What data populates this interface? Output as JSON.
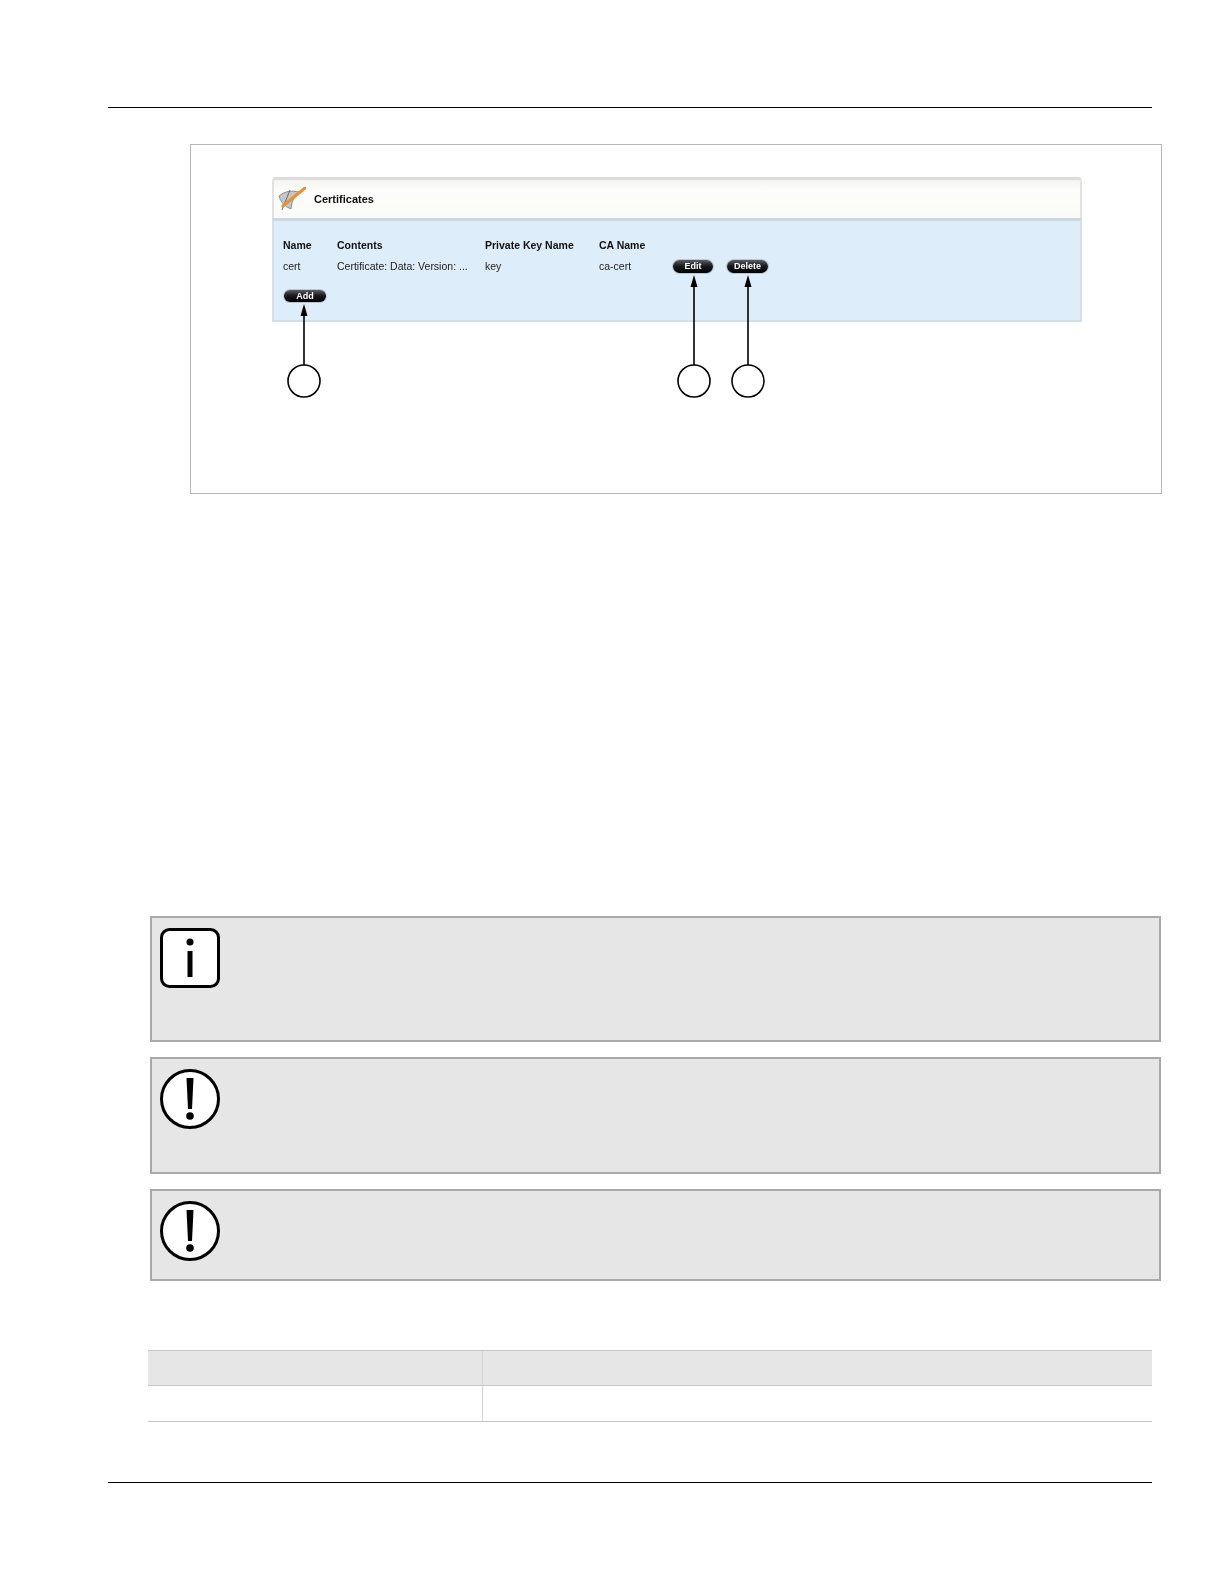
{
  "figure": {
    "panel": {
      "title": "Certificates",
      "columns": [
        "Name",
        "Contents",
        "Private Key Name",
        "CA Name"
      ],
      "rows": [
        {
          "cells": [
            "cert",
            "Certificate: Data: Version: ...",
            "key",
            "ca-cert"
          ],
          "actions": [
            {
              "kind": "edit",
              "label": "Edit"
            },
            {
              "kind": "delete",
              "label": "Delete"
            }
          ]
        }
      ],
      "add_button": "Add"
    }
  },
  "notes": [
    {
      "kind": "info"
    },
    {
      "kind": "warning"
    },
    {
      "kind": "warning"
    }
  ]
}
